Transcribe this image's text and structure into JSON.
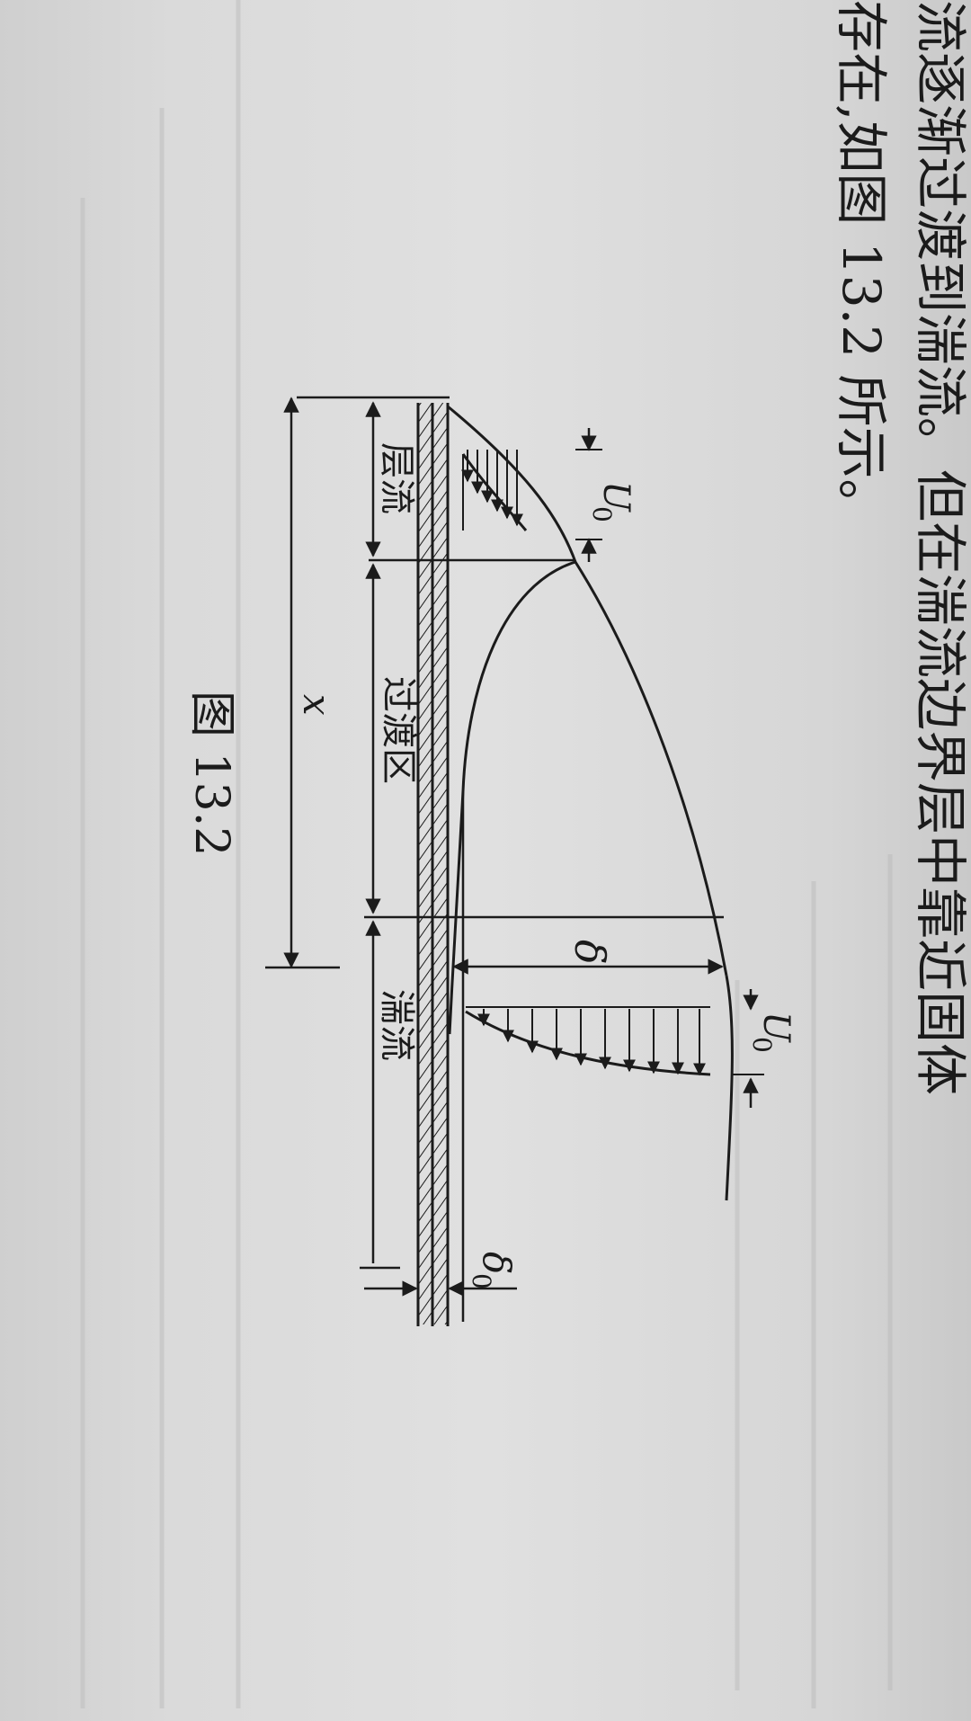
{
  "page": {
    "text_line_1": "流逐渐过渡到湍流。但在湍流边界层中靠近固体",
    "text_line_2": "存在,如图 13.2 所示。",
    "caption": "图  13.2"
  },
  "diagram": {
    "labels": {
      "U0_top": "U",
      "U0_top_sub": "0",
      "U0_bottom": "U",
      "U0_bottom_sub": "0",
      "laminar": "层流",
      "transition": "过渡区",
      "turbulent": "湍流",
      "x": "x",
      "delta": "δ",
      "delta0": "δ",
      "delta0_sub": "0"
    }
  },
  "colors": {
    "ink": "#1b1b1b",
    "paper": "#dcdcdc",
    "bleed_text": "#b9b9b9"
  }
}
